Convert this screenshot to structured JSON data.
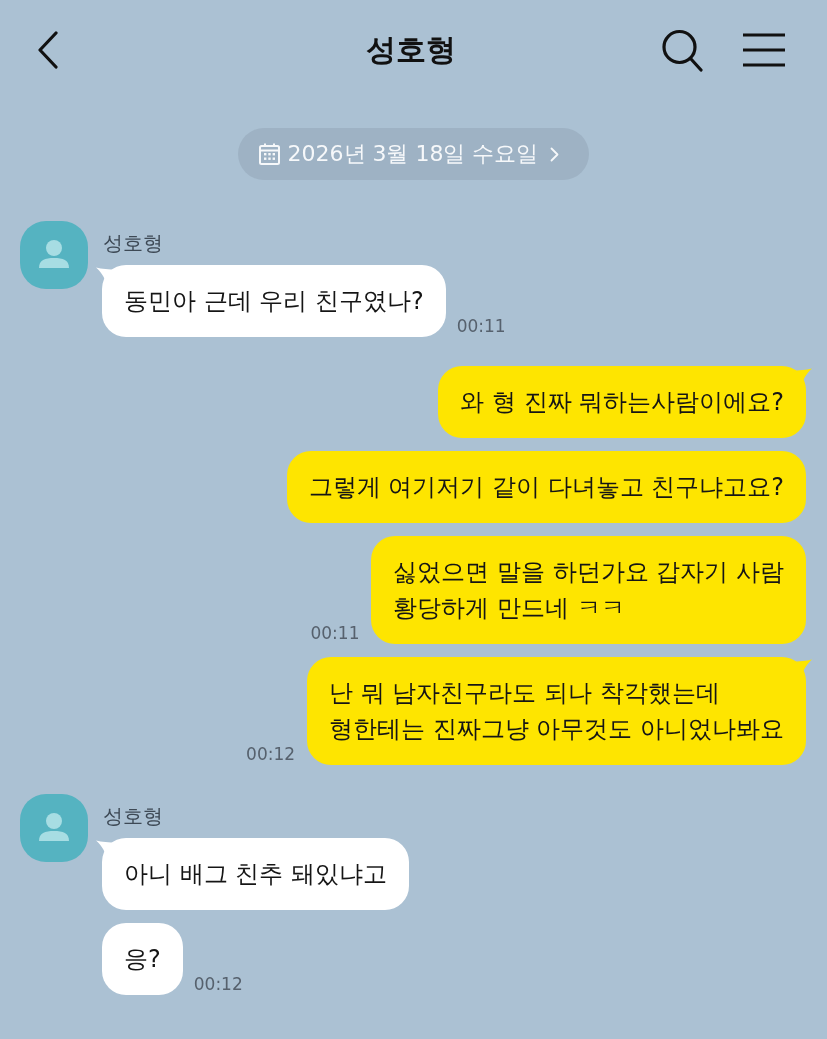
{
  "header": {
    "title": "성호형"
  },
  "date_divider": {
    "label": "2026년 3월 18일 수요일"
  },
  "message_groups": [
    {
      "kind": "received",
      "sender": "성호형",
      "messages": [
        {
          "text": "동민아 근데 우리 친구였나?",
          "time": "00:11",
          "tail": true
        }
      ]
    },
    {
      "kind": "sent",
      "messages": [
        {
          "text": "와 형 진짜 뭐하는사람이에요?",
          "tail": true
        },
        {
          "text": "그렇게 여기저기 같이 다녀놓고 친구냐고요?",
          "tail": false
        },
        {
          "text": "싫었으면 말을 하던가요 갑자기 사람\n황당하게 만드네 ㅋㅋ",
          "time": "00:11",
          "tail": false
        },
        {
          "text": "난 뭐 남자친구라도 되나 착각했는데\n형한테는 진짜그냥 아무것도 아니었나봐요",
          "time": "00:12",
          "tail": true
        }
      ]
    },
    {
      "kind": "received",
      "sender": "성호형",
      "messages": [
        {
          "text": "아니 배그 친추 돼있냐고",
          "tail": true
        },
        {
          "text": "응?",
          "time": "00:12",
          "tail": false
        }
      ]
    }
  ]
}
